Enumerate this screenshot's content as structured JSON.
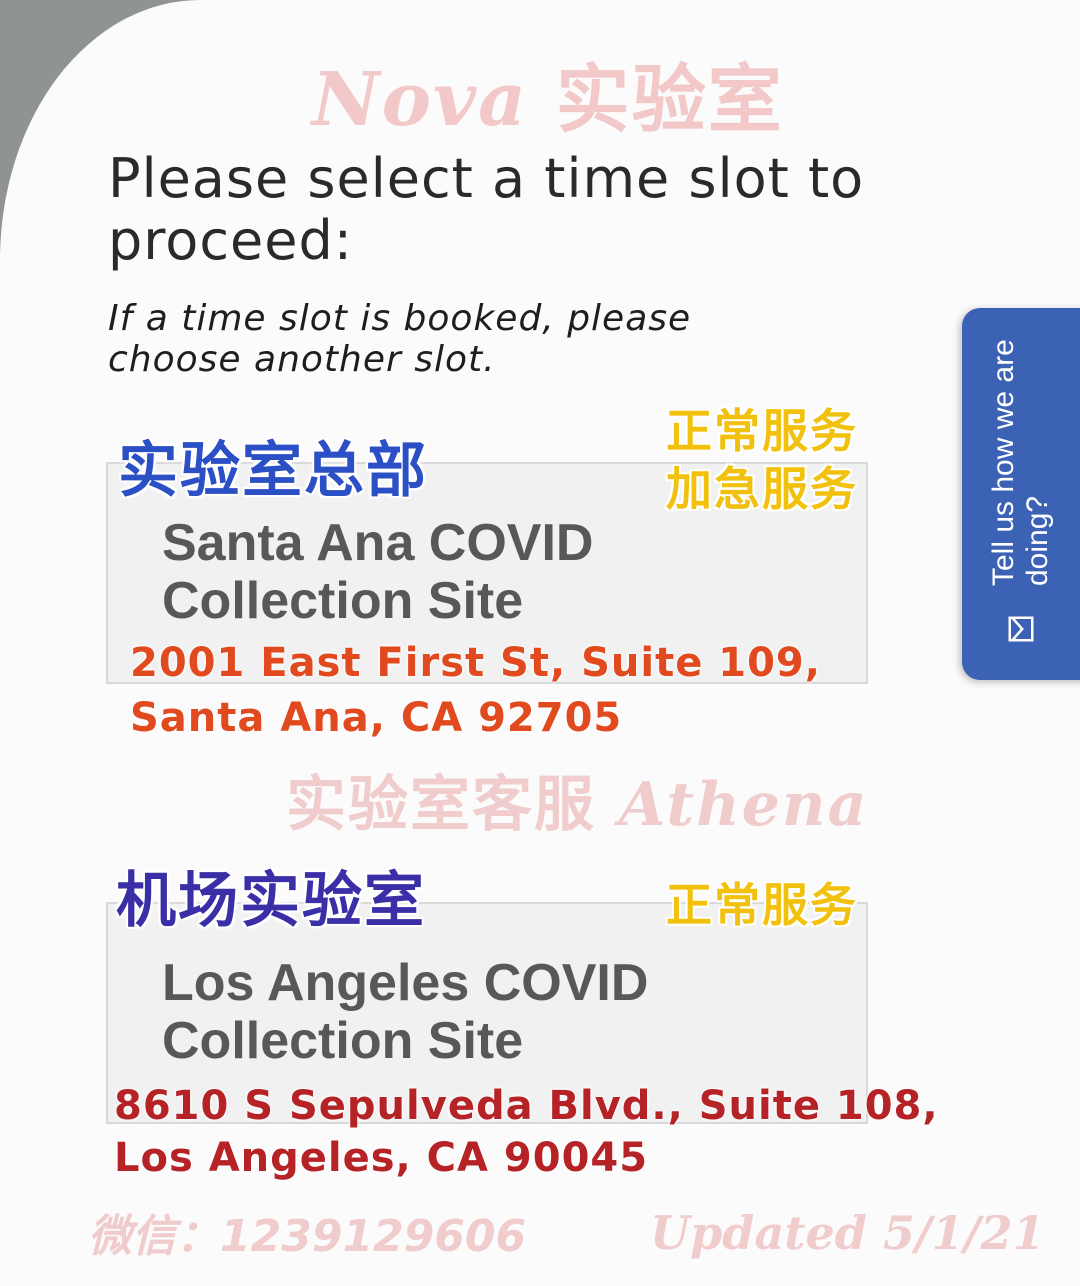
{
  "watermarks": {
    "brand_latin": "Nova",
    "brand_cn": " 实验室",
    "service_cn": "实验室客服 ",
    "service_latin": "Athena",
    "wechat": "微信：1239129606",
    "updated": "Updated 5/1/21"
  },
  "page": {
    "heading": "Please select a time slot to proceed:",
    "subtext": "If a time slot is booked, please choose another slot."
  },
  "locations": [
    {
      "label": "实验室总部",
      "services": [
        "正常服务",
        "加急服务"
      ],
      "site_name": "Santa Ana COVID Collection Site",
      "address_line1": "2001 East First St, Suite 109,",
      "address_line2": "Santa Ana, CA 92705"
    },
    {
      "label": "机场实验室",
      "services": [
        "正常服务"
      ],
      "site_name": "Los Angeles COVID Collection Site",
      "address_line1": "8610 S Sepulveda Blvd., Suite 108,",
      "address_line2": "Los Angeles, CA 90045"
    }
  ],
  "feedback": {
    "label": "Tell us how we are doing?",
    "icon": "feedback-mail-icon"
  },
  "colors": {
    "feedback_bg": "#3b62b5",
    "hq_label": "#2b50c6",
    "airport_label": "#3a2fa6",
    "service_tag": "#f2c10e",
    "hq_address": "#e04a1e",
    "airport_address": "#b52327"
  }
}
